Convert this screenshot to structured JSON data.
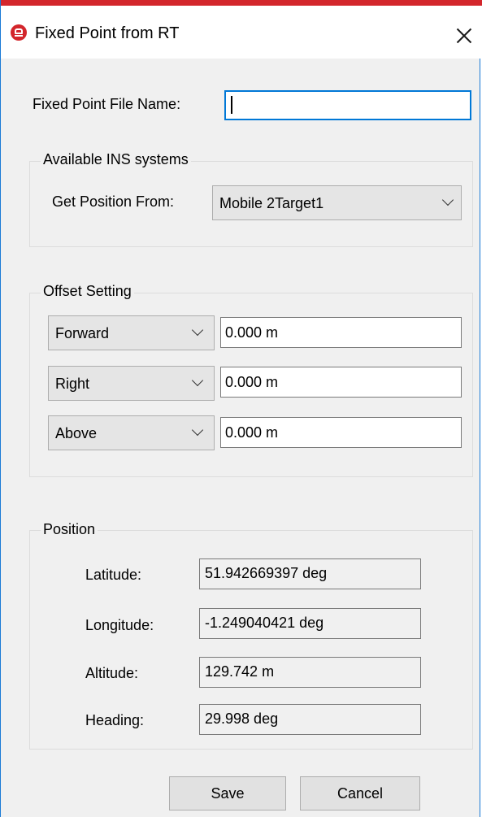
{
  "window": {
    "title": "Fixed Point from RT",
    "accent_color": "#d3262c",
    "border_color": "#1a7ad6",
    "icon": "app-car-icon",
    "close_icon": "close-icon"
  },
  "file_name": {
    "label": "Fixed Point File Name:",
    "value": ""
  },
  "ins_group": {
    "title": "Available INS systems",
    "get_position_label": "Get Position From:",
    "selected": "Mobile 2Target1"
  },
  "offset_group": {
    "title": "Offset Setting",
    "rows": [
      {
        "direction": "Forward",
        "value": "0.000 m"
      },
      {
        "direction": "Right",
        "value": "0.000 m"
      },
      {
        "direction": "Above",
        "value": "0.000 m"
      }
    ]
  },
  "position_group": {
    "title": "Position",
    "fields": [
      {
        "label": "Latitude:",
        "value": "51.942669397 deg"
      },
      {
        "label": "Longitude:",
        "value": "-1.249040421 deg"
      },
      {
        "label": "Altitude:",
        "value": "129.742 m"
      },
      {
        "label": "Heading:",
        "value": "29.998 deg"
      }
    ]
  },
  "buttons": {
    "save": "Save",
    "cancel": "Cancel"
  }
}
